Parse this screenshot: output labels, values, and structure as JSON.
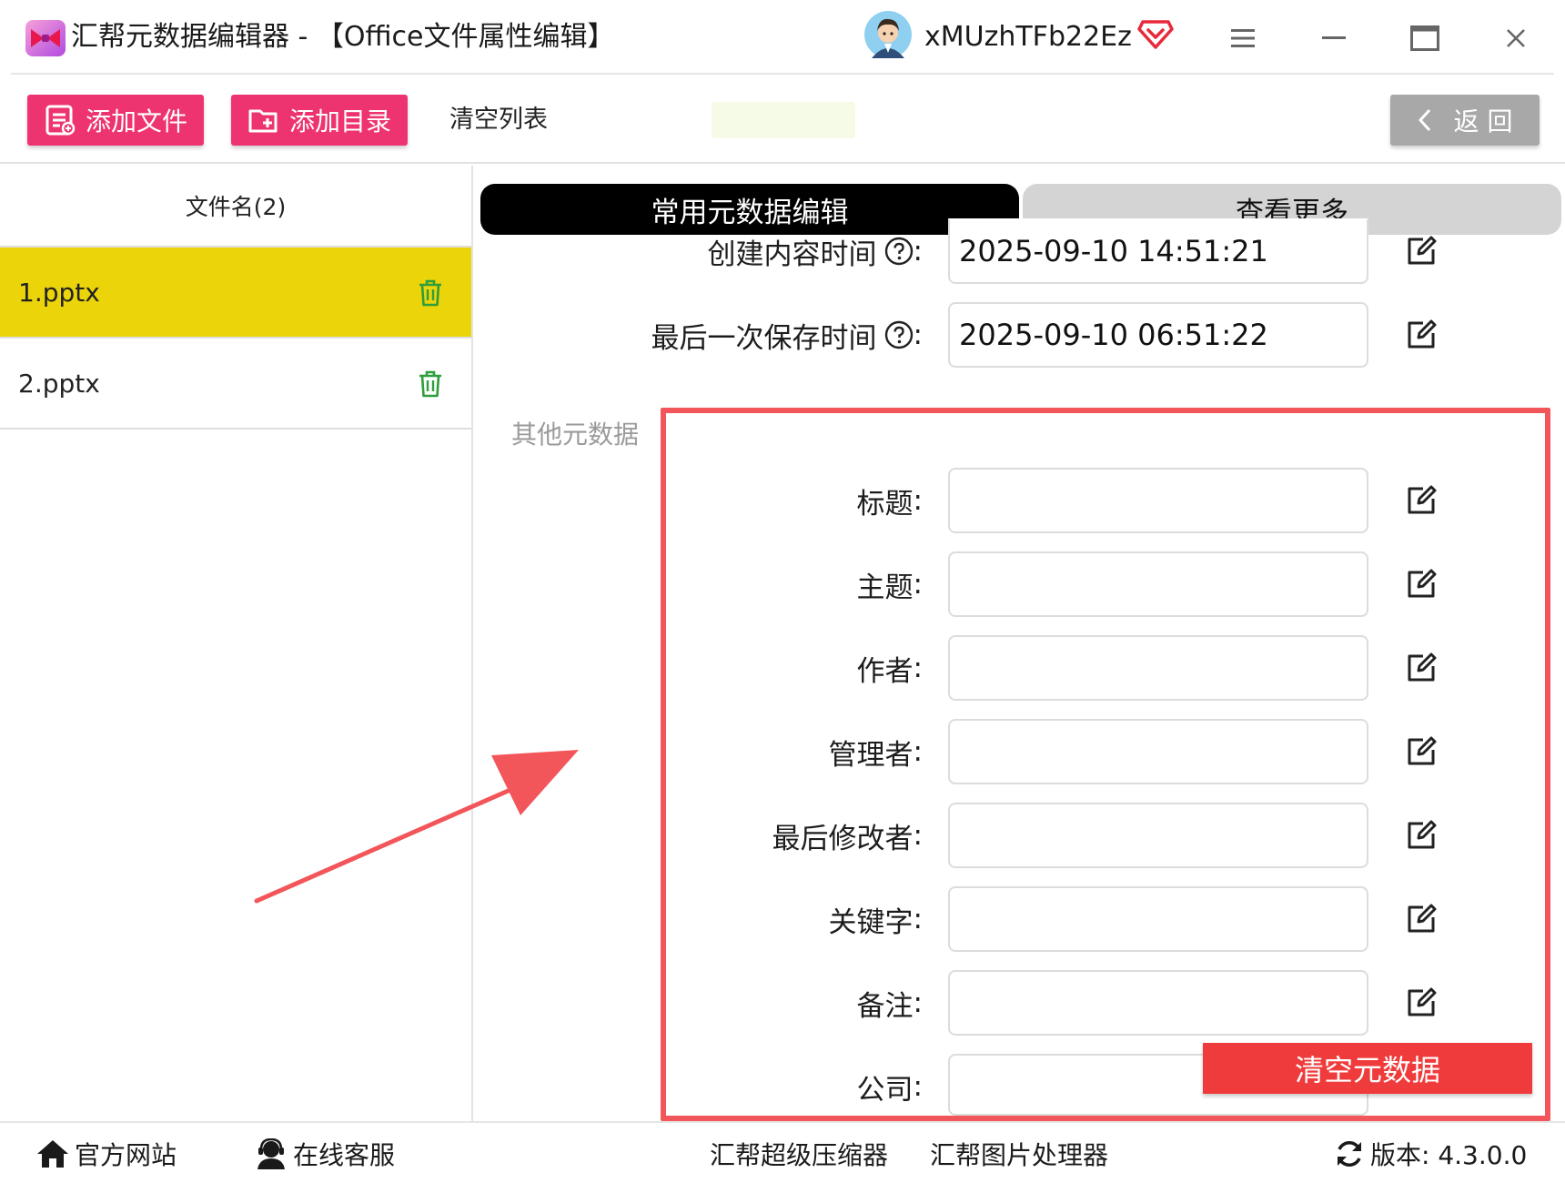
{
  "window": {
    "title": "汇帮元数据编辑器 - 【Office文件属性编辑】",
    "username": "xMUzhTFb22Ez",
    "icons": {
      "logo": "bowtie-logo-icon",
      "avatar": "user-avatar-icon",
      "vip": "vip-diamond-icon",
      "menu": "hamburger-menu-icon",
      "minimize": "minimize-icon",
      "maximize": "maximize-icon",
      "close": "close-icon"
    }
  },
  "toolbar": {
    "add_file": "添加文件",
    "add_folder": "添加目录",
    "clear_list": "清空列表",
    "back": "返 回",
    "colors": {
      "primary": "#ee3470",
      "back": "#a8a8a8"
    }
  },
  "file_panel": {
    "header": "文件名(2)",
    "files": [
      {
        "name": "1.pptx",
        "selected": true
      },
      {
        "name": "2.pptx",
        "selected": false
      }
    ],
    "selected_color": "#ecd40b"
  },
  "tabs": [
    {
      "label": "常用元数据编辑",
      "active": true
    },
    {
      "label": "查看更多",
      "active": false
    }
  ],
  "common_fields": [
    {
      "label": "创建内容时间",
      "value": "2025-09-10 14:51:21",
      "help": true
    },
    {
      "label": "最后一次保存时间",
      "value": "2025-09-10 06:51:22",
      "help": true
    }
  ],
  "other_section": {
    "title": "其他元数据",
    "fields": [
      {
        "label": "标题",
        "value": ""
      },
      {
        "label": "主题",
        "value": ""
      },
      {
        "label": "作者",
        "value": ""
      },
      {
        "label": "管理者",
        "value": ""
      },
      {
        "label": "最后修改者",
        "value": ""
      },
      {
        "label": "关键字",
        "value": ""
      },
      {
        "label": "备注",
        "value": ""
      },
      {
        "label": "公司",
        "value": ""
      }
    ],
    "highlight_color": "#f2555a"
  },
  "actions": {
    "clear_metadata": "清空元数据",
    "clear_color": "#ef3b3b"
  },
  "statusbar": {
    "website": "官方网站",
    "support": "在线客服",
    "compressor": "汇帮超级压缩器",
    "image_tool": "汇帮图片处理器",
    "version": "版本: 4.3.0.0"
  }
}
